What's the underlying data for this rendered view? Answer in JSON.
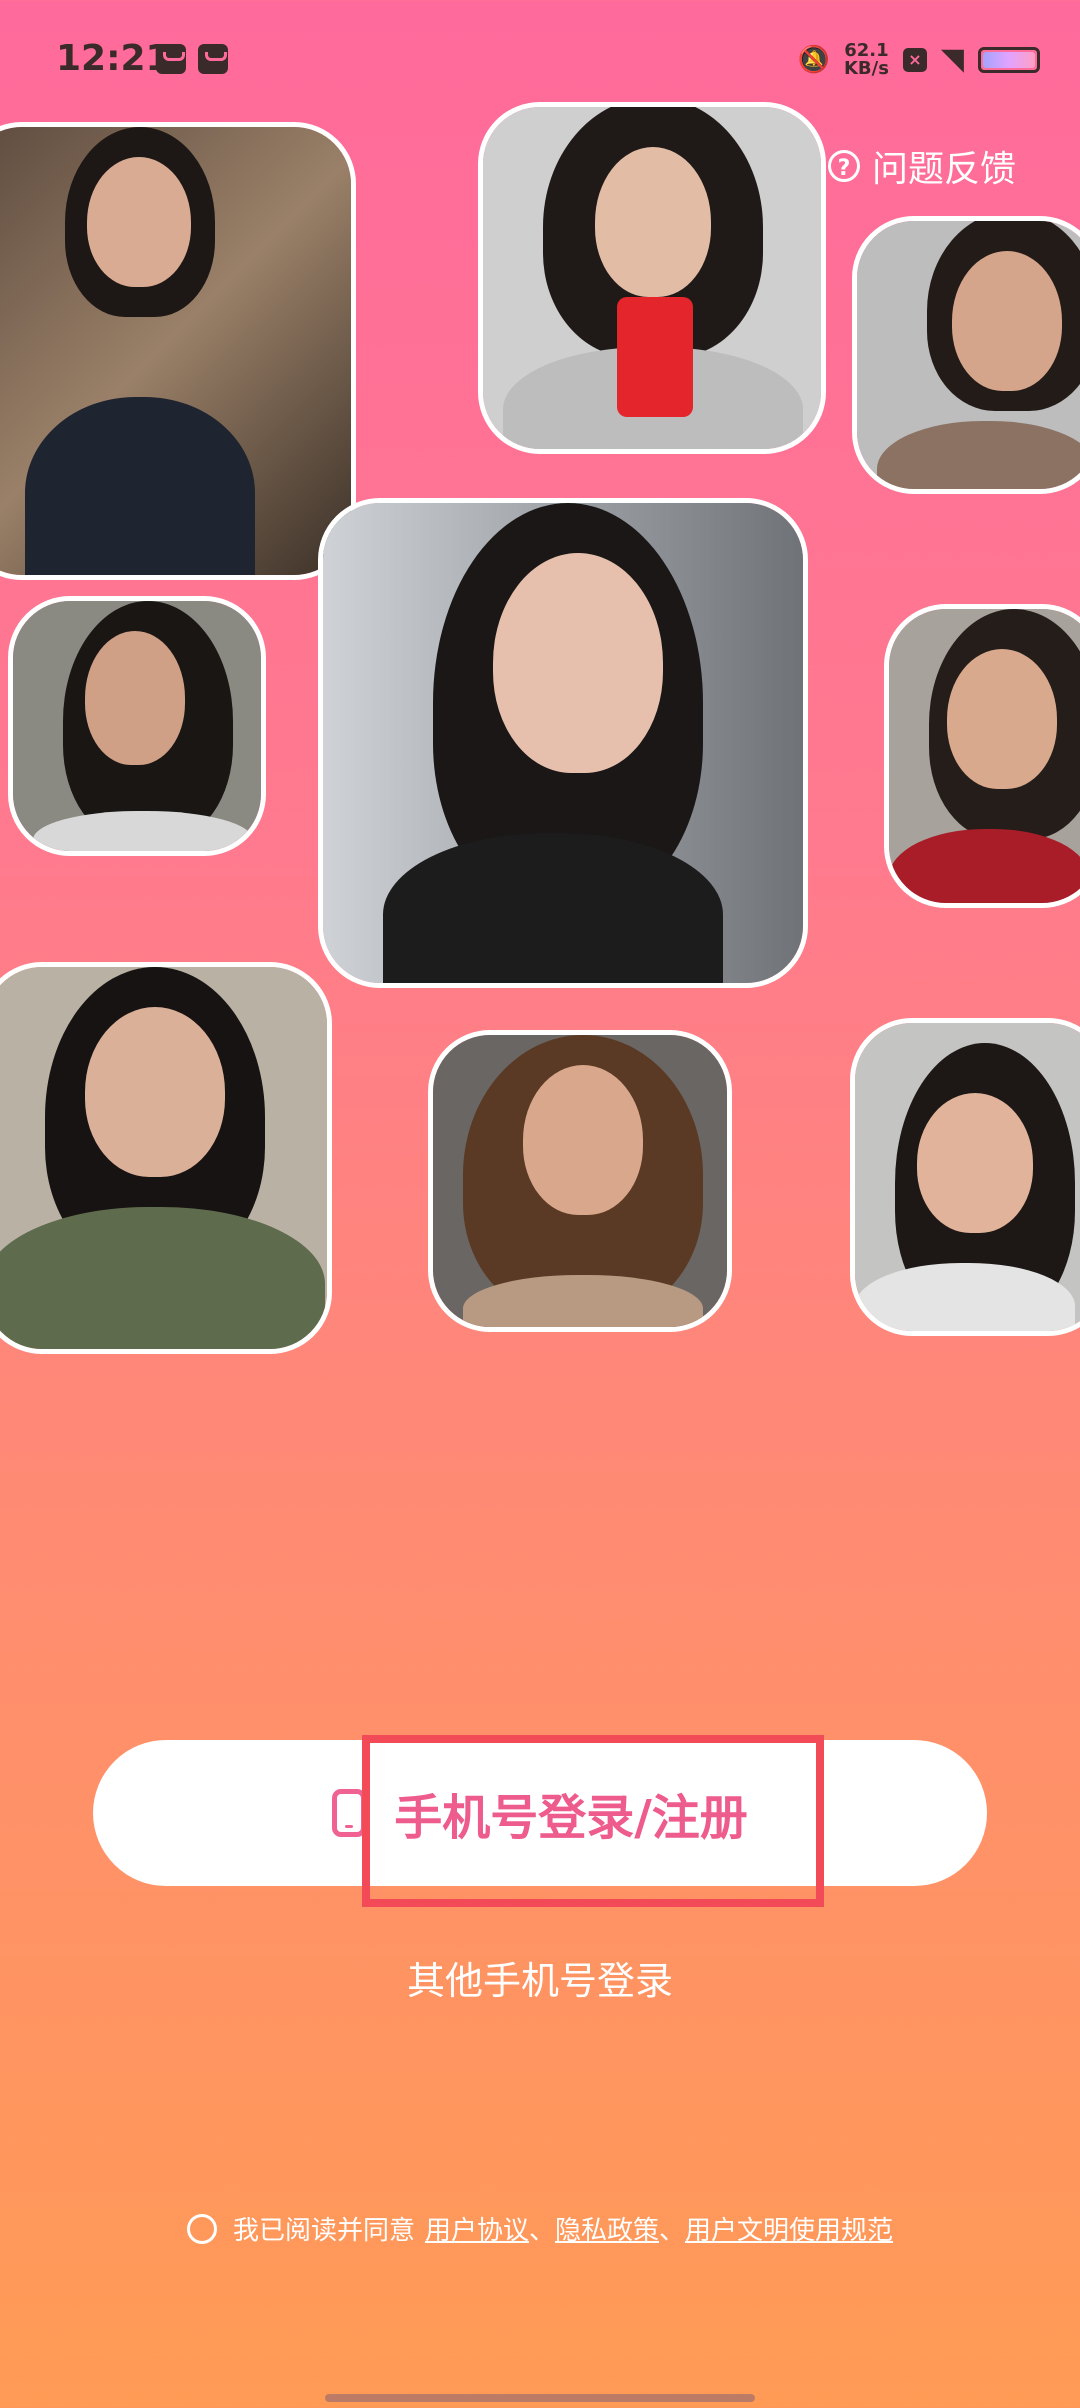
{
  "status_bar": {
    "time": "12:21",
    "speed_value": "62.1",
    "speed_unit": "KB/s"
  },
  "header": {
    "feedback_label": "问题反馈"
  },
  "photos": [
    {
      "alt": "woman-portrait"
    },
    {
      "alt": "woman-with-phone"
    },
    {
      "alt": "woman-portrait"
    },
    {
      "alt": "woman-portrait"
    },
    {
      "alt": "woman-portrait-center"
    },
    {
      "alt": "woman-portrait"
    },
    {
      "alt": "woman-portrait"
    },
    {
      "alt": "woman-portrait"
    },
    {
      "alt": "woman-portrait"
    }
  ],
  "login": {
    "primary_label": "手机号登录/注册",
    "other_label": "其他手机号登录"
  },
  "agreement": {
    "prefix": "我已阅读并同意",
    "user_agreement": "用户协议",
    "sep1": "、",
    "privacy_policy": "隐私政策",
    "sep2": "、",
    "civil_rules": "用户文明使用规范"
  },
  "colors": {
    "accent": "#ee5b8d",
    "highlight": "#f24a57"
  }
}
